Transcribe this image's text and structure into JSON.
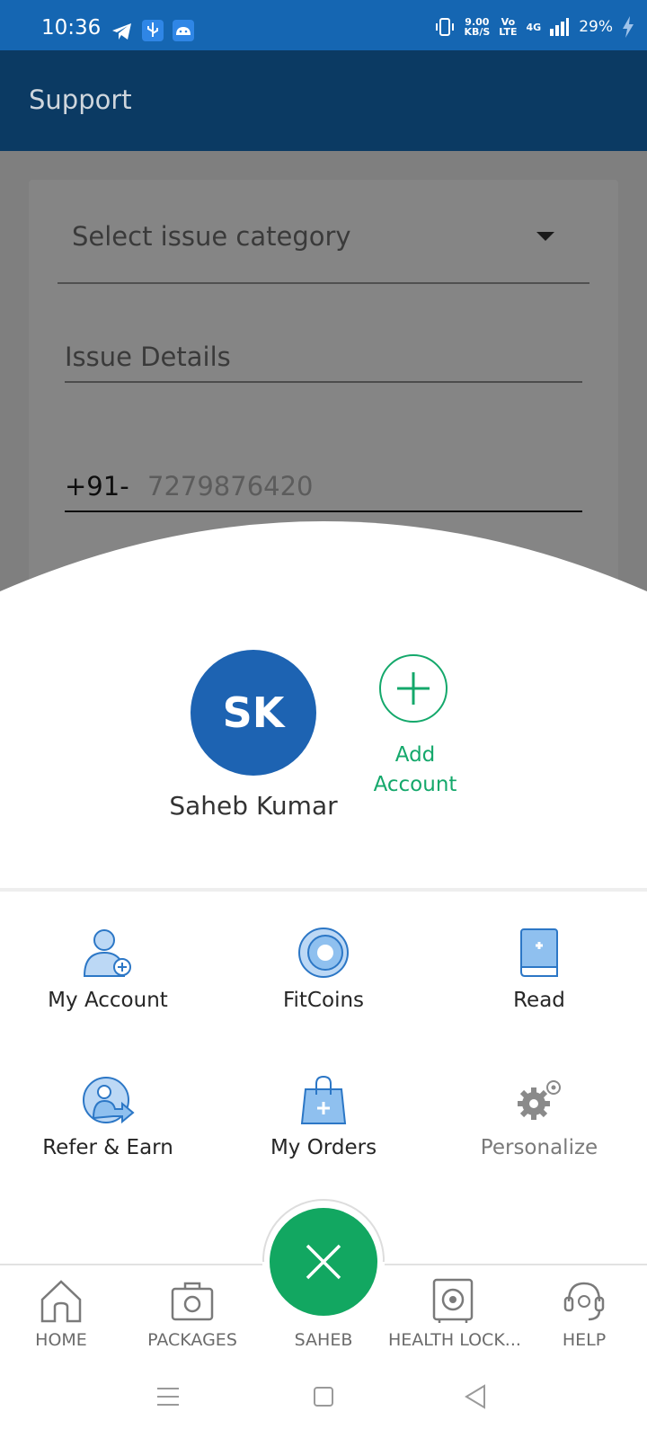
{
  "status_bar": {
    "time": "10:36",
    "speed_value": "9.00",
    "speed_unit": "KB/S",
    "volte_top": "Vo",
    "volte_bottom": "LTE",
    "network": "4G",
    "battery": "29%"
  },
  "app_bar": {
    "title": "Support"
  },
  "form": {
    "category_placeholder": "Select issue category",
    "details_placeholder": "Issue Details",
    "country_code": "+91-",
    "phone_value": "7279876420"
  },
  "profile": {
    "initials": "SK",
    "name": "Saheb Kumar",
    "add_account_line1": "Add",
    "add_account_line2": "Account",
    "accent": "#14a86b",
    "avatar_color": "#1d63b2"
  },
  "menu": {
    "my_account": "My Account",
    "fitcoins": "FitCoins",
    "read": "Read",
    "refer_earn": "Refer & Earn",
    "my_orders": "My Orders",
    "personalize": "Personalize"
  },
  "bottom_nav": {
    "home": "HOME",
    "packages": "PACKAGES",
    "center": "SAHEB",
    "health_locker": "HEALTH LOCK...",
    "help": "HELP"
  },
  "icons": {
    "status": [
      "telegram-icon",
      "usb-icon",
      "android-icon",
      "vibrate-icon",
      "signal-icon",
      "charging-icon"
    ],
    "menu": [
      "user-add-icon",
      "coin-icon",
      "book-icon",
      "refer-icon",
      "shopping-bag-icon",
      "gears-icon"
    ],
    "nav": [
      "home-icon",
      "briefcase-icon",
      "close-icon",
      "safe-icon",
      "headset-icon"
    ]
  }
}
